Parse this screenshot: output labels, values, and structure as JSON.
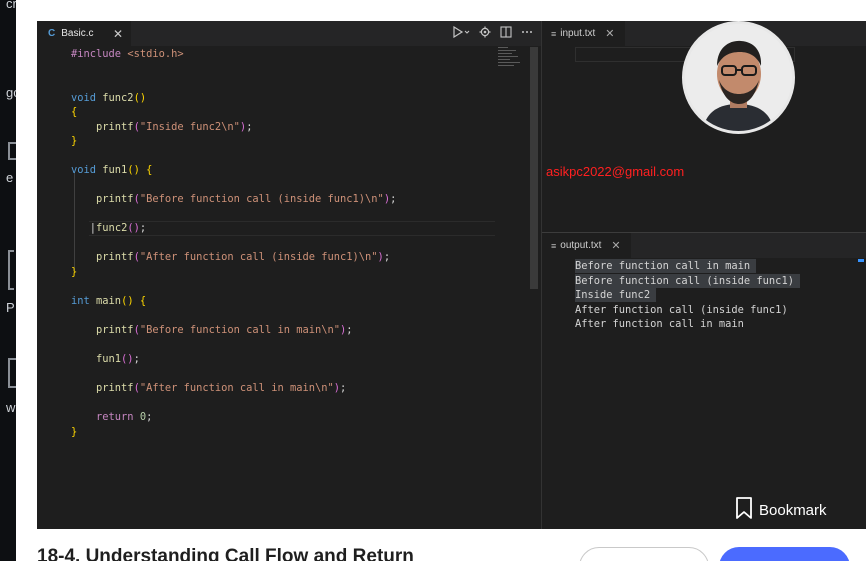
{
  "left_sidebar_fragments": [
    "cr",
    "gc",
    "e",
    "P",
    "w"
  ],
  "editor": {
    "tab": {
      "icon": "C",
      "filename": "Basic.c",
      "close": "✕"
    },
    "toolbar": [
      "run-debug-icon",
      "gear-icon",
      "split-editor-icon",
      "more-icon"
    ],
    "lines": [
      [
        {
          "t": "#include ",
          "c": "pp"
        },
        {
          "t": "<stdio.h>",
          "c": "inc"
        }
      ],
      [],
      [
        {
          "t": "void ",
          "c": "kw"
        },
        {
          "t": "func2",
          "c": "fn"
        },
        {
          "t": "()",
          "c": "br"
        }
      ],
      [
        {
          "t": "{",
          "c": "br"
        }
      ],
      [
        {
          "t": "    printf",
          "c": "fn"
        },
        {
          "t": "(",
          "c": "br2"
        },
        {
          "t": "\"Inside func2\\n\"",
          "c": "str"
        },
        {
          "t": ")",
          "c": "br2"
        },
        {
          "t": ";",
          "c": "pl"
        }
      ],
      [
        {
          "t": "}",
          "c": "br"
        }
      ],
      [],
      [
        {
          "t": "void ",
          "c": "kw"
        },
        {
          "t": "fun1",
          "c": "fn"
        },
        {
          "t": "() ",
          "c": "br"
        },
        {
          "t": "{",
          "c": "br"
        }
      ],
      [],
      [
        {
          "t": "    printf",
          "c": "fn"
        },
        {
          "t": "(",
          "c": "br2"
        },
        {
          "t": "\"Before function call (inside func1)\\n\"",
          "c": "str"
        },
        {
          "t": ")",
          "c": "br2"
        },
        {
          "t": ";",
          "c": "pl"
        }
      ],
      [],
      [
        {
          "t": "   ",
          "c": "pl"
        },
        {
          "t": "|",
          "c": "pl"
        },
        {
          "t": "func2",
          "c": "fn"
        },
        {
          "t": "()",
          "c": "br2"
        },
        {
          "t": ";",
          "c": "pl"
        }
      ],
      [],
      [
        {
          "t": "    printf",
          "c": "fn"
        },
        {
          "t": "(",
          "c": "br2"
        },
        {
          "t": "\"After function call (inside func1)\\n\"",
          "c": "str"
        },
        {
          "t": ")",
          "c": "br2"
        },
        {
          "t": ";",
          "c": "pl"
        }
      ],
      [
        {
          "t": "}",
          "c": "br"
        }
      ],
      [],
      [
        {
          "t": "int ",
          "c": "kw"
        },
        {
          "t": "main",
          "c": "fn"
        },
        {
          "t": "() ",
          "c": "br"
        },
        {
          "t": "{",
          "c": "br"
        }
      ],
      [],
      [
        {
          "t": "    printf",
          "c": "fn"
        },
        {
          "t": "(",
          "c": "br2"
        },
        {
          "t": "\"Before function call in main\\n\"",
          "c": "str"
        },
        {
          "t": ")",
          "c": "br2"
        },
        {
          "t": ";",
          "c": "pl"
        }
      ],
      [],
      [
        {
          "t": "    fun1",
          "c": "fn"
        },
        {
          "t": "()",
          "c": "br2"
        },
        {
          "t": ";",
          "c": "pl"
        }
      ],
      [],
      [
        {
          "t": "    printf",
          "c": "fn"
        },
        {
          "t": "(",
          "c": "br2"
        },
        {
          "t": "\"After function call in main\\n\"",
          "c": "str"
        },
        {
          "t": ")",
          "c": "br2"
        },
        {
          "t": ";",
          "c": "pl"
        }
      ],
      [],
      [
        {
          "t": "    return ",
          "c": "kw2"
        },
        {
          "t": "0",
          "c": "num"
        },
        {
          "t": ";",
          "c": "pl"
        }
      ],
      [
        {
          "t": "}",
          "c": "br"
        }
      ]
    ]
  },
  "input_panel": {
    "tab_label": "input.txt",
    "close": "✕"
  },
  "email_overlay": "asikpc2022@gmail.com",
  "output_panel": {
    "tab_label": "output.txt",
    "close": "✕",
    "lines": [
      {
        "text": "Before function call in main",
        "selected": true
      },
      {
        "text": "Before function call (inside func1)",
        "selected": true
      },
      {
        "text": "Inside func2",
        "selected": true
      },
      {
        "text": "After function call (inside func1)",
        "selected": false
      },
      {
        "text": "After function call in main",
        "selected": false
      }
    ]
  },
  "bookmark_label": "Bookmark",
  "lesson_title": "18-4. Understanding Call Flow and Return",
  "colors": {
    "editor_bg": "#1e1e1e",
    "email": "#ff2020",
    "primary_button": "#4b6bff"
  }
}
